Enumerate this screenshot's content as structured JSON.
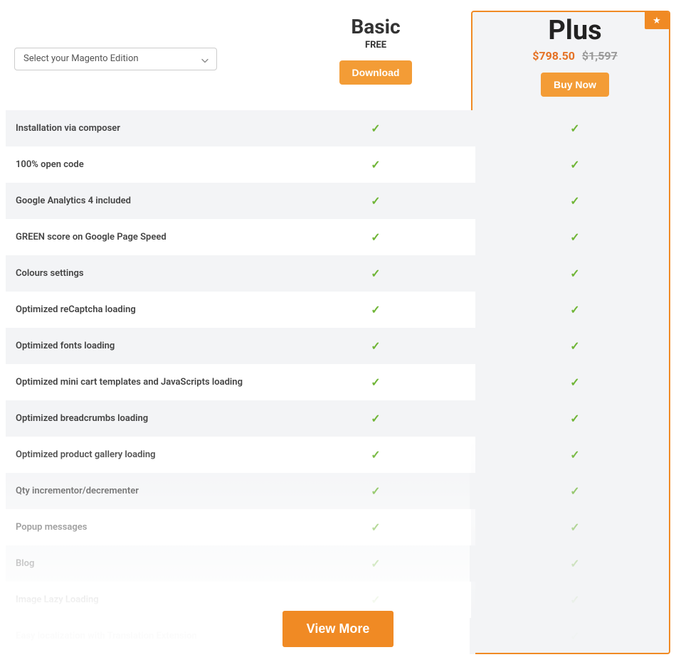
{
  "select": {
    "placeholder": "Select your Magento Edition"
  },
  "plans": {
    "basic": {
      "title": "Basic",
      "subtitle": "FREE",
      "cta": "Download"
    },
    "plus": {
      "title": "Plus",
      "price_current": "$798.50",
      "price_old": "$1,597",
      "cta": "Buy Now"
    }
  },
  "features": [
    {
      "label": "Installation via composer",
      "basic": true,
      "plus": true
    },
    {
      "label": "100% open code",
      "basic": true,
      "plus": true
    },
    {
      "label": "Google Analytics 4 included",
      "basic": true,
      "plus": true
    },
    {
      "label": "GREEN score on Google Page Speed",
      "basic": true,
      "plus": true
    },
    {
      "label": "Colours settings",
      "basic": true,
      "plus": true
    },
    {
      "label": "Optimized reCaptcha loading",
      "basic": true,
      "plus": true
    },
    {
      "label": "Optimized fonts loading",
      "basic": true,
      "plus": true
    },
    {
      "label": "Optimized mini cart templates and JavaScripts loading",
      "basic": true,
      "plus": true
    },
    {
      "label": "Optimized breadcrumbs loading",
      "basic": true,
      "plus": true
    },
    {
      "label": "Optimized product gallery loading",
      "basic": true,
      "plus": true
    },
    {
      "label": "Qty incrementor/decrementer",
      "basic": true,
      "plus": true
    },
    {
      "label": "Popup messages",
      "basic": true,
      "plus": true
    },
    {
      "label": "Blog",
      "basic": true,
      "plus": true
    },
    {
      "label": "Image Lazy Loading",
      "basic": true,
      "plus": true
    },
    {
      "label": "Easy localization with Translation Extension",
      "basic": true,
      "plus": true
    }
  ],
  "viewMore": "View More",
  "icons": {
    "check": "✓",
    "star": "★"
  },
  "colors": {
    "accent": "#f08a24",
    "check": "#6fb536"
  }
}
